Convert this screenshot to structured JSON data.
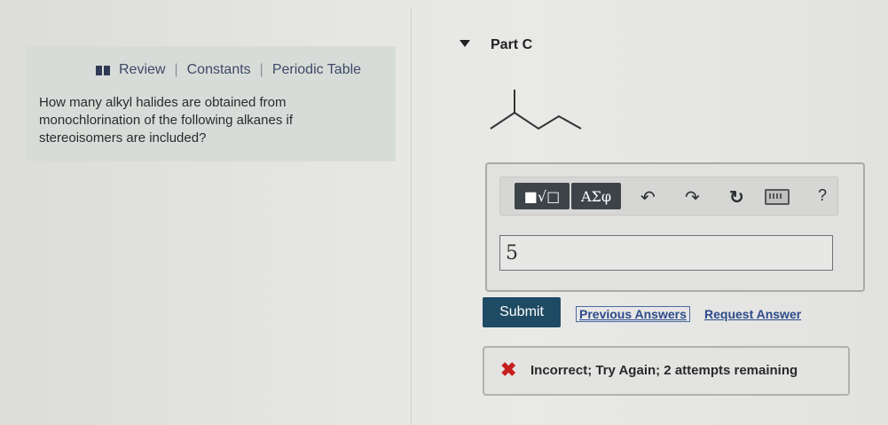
{
  "left_panel": {
    "links": [
      "Review",
      "Constants",
      "Periodic Table"
    ],
    "link_separator": "|",
    "question": "How many alkyl halides are obtained from monochlorination of the following alkanes if stereoisomers are included?"
  },
  "part": {
    "title": "Part C",
    "molecule_icon": "skeletal-structure"
  },
  "toolbar": {
    "templates_label": "■√□",
    "greek_label": "ΑΣφ",
    "undo_icon": "↶",
    "redo_icon": "↷",
    "reset_icon": "↻",
    "help_label": "?"
  },
  "answer": {
    "value": "5"
  },
  "actions": {
    "submit_label": "Submit",
    "previous_answers_label": "Previous Answers",
    "request_answer_label": "Request Answer"
  },
  "feedback": {
    "icon": "✖",
    "text": "Incorrect; Try Again; 2 attempts remaining",
    "color": "#c61f1f"
  }
}
